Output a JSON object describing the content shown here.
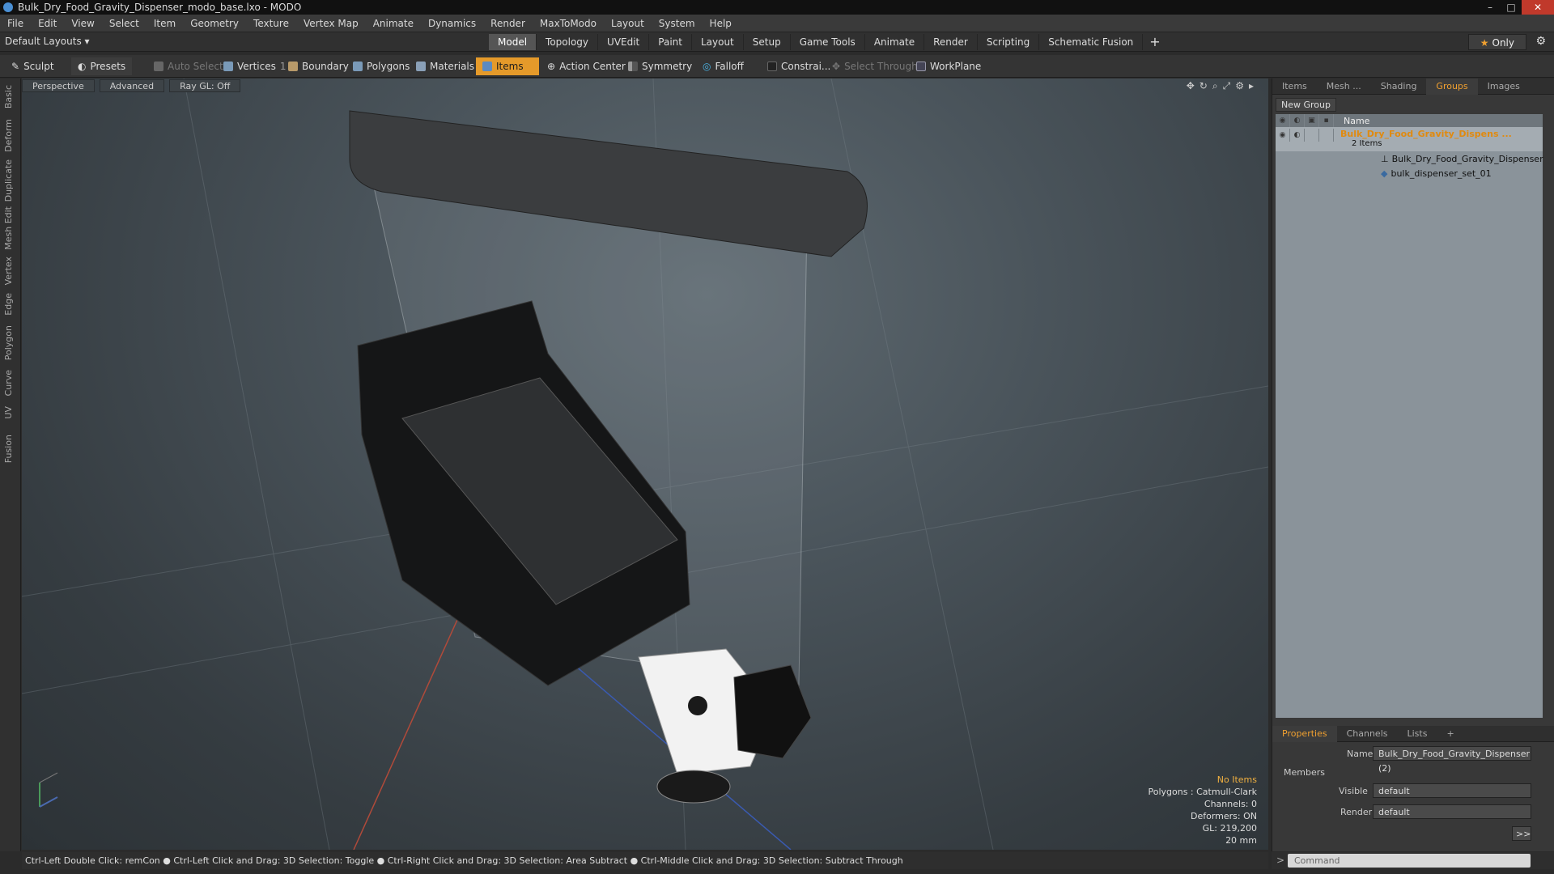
{
  "window": {
    "title": "Bulk_Dry_Food_Gravity_Dispenser_modo_base.lxo - MODO",
    "controls": [
      "–",
      "□",
      "✕"
    ]
  },
  "menu": [
    "File",
    "Edit",
    "View",
    "Select",
    "Item",
    "Geometry",
    "Texture",
    "Vertex Map",
    "Animate",
    "Dynamics",
    "Render",
    "MaxToModo",
    "Layout",
    "System",
    "Help"
  ],
  "layoutbar": {
    "default_layouts": "Default Layouts ▾",
    "tabs": [
      "Model",
      "Topology",
      "UVEdit",
      "Paint",
      "Layout",
      "Setup",
      "Game Tools",
      "Animate",
      "Render",
      "Scripting",
      "Schematic Fusion"
    ],
    "active_tab": "Model",
    "plus": "+",
    "only": "Only"
  },
  "toolbar": {
    "sculpt": "Sculpt",
    "presets": "Presets",
    "auto_select": "Auto Select",
    "vertices": "Vertices",
    "vertices_count": "1",
    "boundary": "Boundary",
    "polygons": "Polygons",
    "materials": "Materials",
    "items": "Items",
    "action_center": "Action Center",
    "symmetry": "Symmetry",
    "falloff": "Falloff",
    "constrain": "Constrai...",
    "select_through": "Select Through",
    "workplane": "WorkPlane"
  },
  "left_tabs": [
    "Basic",
    "Deform",
    "Duplicate",
    "Mesh Edit",
    "Vertex",
    "Edge",
    "Polygon",
    "Curve",
    "UV",
    "Fusion"
  ],
  "viewport": {
    "view": "Perspective",
    "shading": "Advanced",
    "raygl": "Ray GL: Off"
  },
  "hud": {
    "no_items": "No Items",
    "polygons": "Polygons : Catmull-Clark",
    "channels": "Channels: 0",
    "deformers": "Deformers: ON",
    "gl": "GL: 219,200",
    "scale": "20 mm"
  },
  "right_panel": {
    "tabs": [
      "Items",
      "Mesh ...",
      "Shading",
      "Groups",
      "Images"
    ],
    "active_tab": "Groups",
    "new_group": "New Group",
    "name_header": "Name",
    "group": {
      "name": "Bulk_Dry_Food_Gravity_Dispens ...",
      "count": "2 Items"
    },
    "children": [
      "Bulk_Dry_Food_Gravity_Dispenser",
      "bulk_dispenser_set_01"
    ]
  },
  "properties": {
    "tabs": [
      "Properties",
      "Channels",
      "Lists",
      "+"
    ],
    "active_tab": "Properties",
    "name_label": "Name",
    "name_value": "Bulk_Dry_Food_Gravity_Dispenser (2)",
    "members": "Members",
    "visible_label": "Visible",
    "visible_value": "default",
    "render_label": "Render",
    "render_value": "default",
    "more": ">>"
  },
  "status": "Ctrl-Left Double Click: remCon ● Ctrl-Left Click and Drag: 3D Selection: Toggle ● Ctrl-Right Click and Drag: 3D Selection: Area Subtract ● Ctrl-Middle Click and Drag: 3D Selection: Subtract Through",
  "command": {
    "placeholder": "Command"
  },
  "colors": {
    "accent": "#e59a2a",
    "viewport": "#4a545b",
    "group_list": "#8a939a"
  }
}
